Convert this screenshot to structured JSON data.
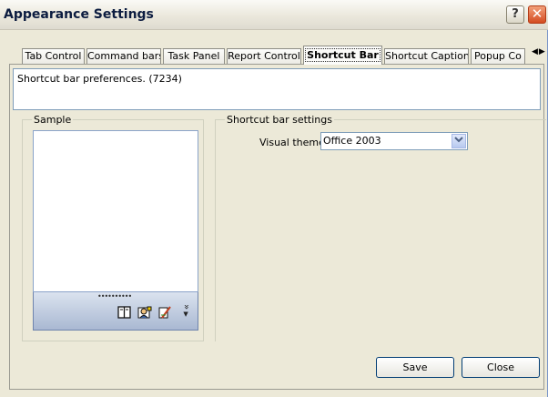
{
  "window": {
    "title": "Appearance Settings",
    "help_glyph": "?",
    "close_glyph": "✕"
  },
  "tabs": [
    {
      "label": "Tab Control"
    },
    {
      "label": "Command bars"
    },
    {
      "label": "Task Panel"
    },
    {
      "label": "Report Control"
    },
    {
      "label": "Shortcut Bar",
      "active": true
    },
    {
      "label": "Shortcut Caption"
    },
    {
      "label": "Popup Co"
    }
  ],
  "tab_scroll": {
    "left": "◀",
    "right": "▶"
  },
  "description": "Shortcut bar preferences. (7234)",
  "sample": {
    "legend": "Sample",
    "gripper": "••••••••••",
    "icons": [
      "notebook-icon",
      "contacts-icon",
      "notes-pencil-icon"
    ],
    "chevron": "»"
  },
  "settings": {
    "legend": "Shortcut bar settings",
    "visual_theme_label": "Visual theme:",
    "visual_theme_value": "Office 2003"
  },
  "buttons": {
    "save": "Save",
    "close": "Close"
  }
}
